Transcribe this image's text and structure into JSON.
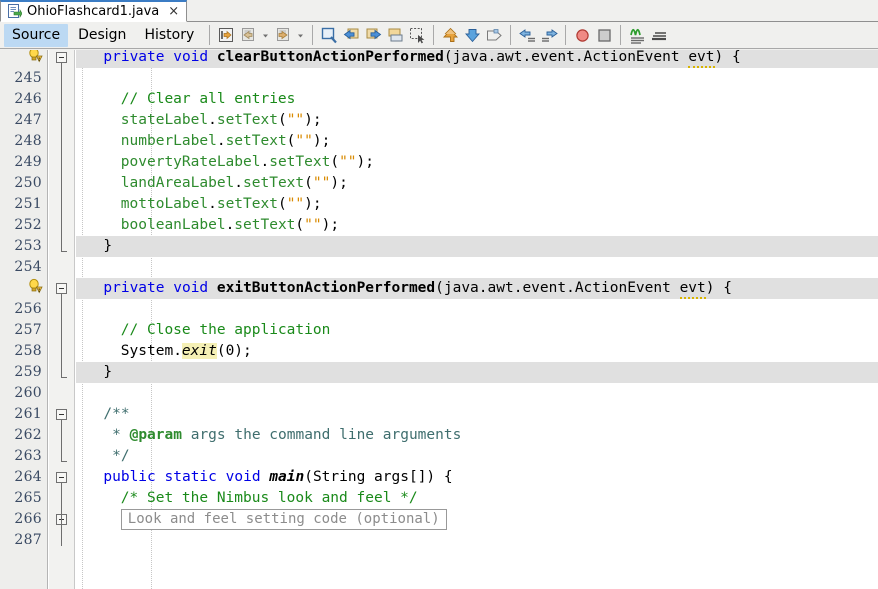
{
  "window": {
    "document_tab": {
      "label": "OhioFlashcard1.java",
      "close_glyph": "×",
      "icon": "java-file-icon"
    },
    "view_tabs": [
      {
        "label": "Source",
        "selected": true
      },
      {
        "label": "Design",
        "selected": false
      },
      {
        "label": "History",
        "selected": false
      }
    ],
    "toolbar": {
      "groups": [
        {
          "items": [
            {
              "name": "last-edit-icon"
            },
            {
              "name": "back-icon"
            },
            {
              "name": "back-dropdown-icon"
            },
            {
              "name": "forward-icon"
            },
            {
              "name": "forward-dropdown-icon"
            }
          ]
        },
        {
          "items": [
            {
              "name": "find-selection-icon"
            },
            {
              "name": "previous-bookmark-icon"
            },
            {
              "name": "next-bookmark-icon"
            },
            {
              "name": "toggle-bookmark-icon"
            },
            {
              "name": "rectangular-selection-icon"
            }
          ]
        },
        {
          "items": [
            {
              "name": "shift-line-up-icon"
            },
            {
              "name": "shift-line-down-icon"
            },
            {
              "name": "comment-icon"
            }
          ]
        },
        {
          "items": [
            {
              "name": "shift-left-icon"
            },
            {
              "name": "shift-right-icon"
            }
          ]
        },
        {
          "items": [
            {
              "name": "toggle-breakpoint-icon"
            },
            {
              "name": "stop-icon"
            }
          ]
        },
        {
          "items": [
            {
              "name": "toggle-highlight-icon"
            },
            {
              "name": "toggle-rectangular-icon"
            }
          ]
        }
      ]
    }
  },
  "editor": {
    "first_visible_line_partial": true,
    "lines": [
      {
        "num": "",
        "indent": 2,
        "highlight": true,
        "fold": "minus",
        "annotation": "warning-bulb-icon",
        "tokens": [
          {
            "t": "private",
            "c": "kw"
          },
          {
            "t": " ",
            "c": ""
          },
          {
            "t": "void",
            "c": "kw"
          },
          {
            "t": " ",
            "c": ""
          },
          {
            "t": "clearButtonActionPerformed",
            "c": "mname"
          },
          {
            "t": "(java.awt.event.ActionEvent ",
            "c": ""
          },
          {
            "t": "evt",
            "c": "warnu"
          },
          {
            "t": ") {",
            "c": ""
          }
        ]
      },
      {
        "num": "245",
        "indent": 0,
        "highlight": false,
        "tokens": []
      },
      {
        "num": "246",
        "indent": 4,
        "highlight": false,
        "tokens": [
          {
            "t": "// Clear all entries",
            "c": "cmt"
          }
        ]
      },
      {
        "num": "247",
        "indent": 4,
        "highlight": false,
        "tokens": [
          {
            "t": "stateLabel",
            "c": "fld"
          },
          {
            "t": ".",
            "c": ""
          },
          {
            "t": "setText",
            "c": "fld"
          },
          {
            "t": "(",
            "c": ""
          },
          {
            "t": "\"\"",
            "c": "str"
          },
          {
            "t": ");",
            "c": ""
          }
        ]
      },
      {
        "num": "248",
        "indent": 4,
        "highlight": false,
        "tokens": [
          {
            "t": "numberLabel",
            "c": "fld"
          },
          {
            "t": ".",
            "c": ""
          },
          {
            "t": "setText",
            "c": "fld"
          },
          {
            "t": "(",
            "c": ""
          },
          {
            "t": "\"\"",
            "c": "str"
          },
          {
            "t": ");",
            "c": ""
          }
        ]
      },
      {
        "num": "249",
        "indent": 4,
        "highlight": false,
        "tokens": [
          {
            "t": "povertyRateLabel",
            "c": "fld"
          },
          {
            "t": ".",
            "c": ""
          },
          {
            "t": "setText",
            "c": "fld"
          },
          {
            "t": "(",
            "c": ""
          },
          {
            "t": "\"\"",
            "c": "str"
          },
          {
            "t": ");",
            "c": ""
          }
        ]
      },
      {
        "num": "250",
        "indent": 4,
        "highlight": false,
        "tokens": [
          {
            "t": "landAreaLabel",
            "c": "fld"
          },
          {
            "t": ".",
            "c": ""
          },
          {
            "t": "setText",
            "c": "fld"
          },
          {
            "t": "(",
            "c": ""
          },
          {
            "t": "\"\"",
            "c": "str"
          },
          {
            "t": ");",
            "c": ""
          }
        ]
      },
      {
        "num": "251",
        "indent": 4,
        "highlight": false,
        "tokens": [
          {
            "t": "mottoLabel",
            "c": "fld"
          },
          {
            "t": ".",
            "c": ""
          },
          {
            "t": "setText",
            "c": "fld"
          },
          {
            "t": "(",
            "c": ""
          },
          {
            "t": "\"\"",
            "c": "str"
          },
          {
            "t": ");",
            "c": ""
          }
        ]
      },
      {
        "num": "252",
        "indent": 4,
        "highlight": false,
        "tokens": [
          {
            "t": "booleanLabel",
            "c": "fld"
          },
          {
            "t": ".",
            "c": ""
          },
          {
            "t": "setText",
            "c": "fld"
          },
          {
            "t": "(",
            "c": ""
          },
          {
            "t": "\"\"",
            "c": "str"
          },
          {
            "t": ");",
            "c": ""
          }
        ]
      },
      {
        "num": "253",
        "indent": 2,
        "highlight": true,
        "fold": "end",
        "tokens": [
          {
            "t": "}",
            "c": ""
          }
        ]
      },
      {
        "num": "254",
        "indent": 0,
        "highlight": false,
        "tokens": []
      },
      {
        "num": "",
        "indent": 2,
        "highlight": true,
        "fold": "minus",
        "annotation": "warning-bulb-icon",
        "tokens": [
          {
            "t": "private",
            "c": "kw"
          },
          {
            "t": " ",
            "c": ""
          },
          {
            "t": "void",
            "c": "kw"
          },
          {
            "t": " ",
            "c": ""
          },
          {
            "t": "exitButtonActionPerformed",
            "c": "mname"
          },
          {
            "t": "(java.awt.event.ActionEvent ",
            "c": ""
          },
          {
            "t": "evt",
            "c": "warnu"
          },
          {
            "t": ") {",
            "c": ""
          }
        ]
      },
      {
        "num": "256",
        "indent": 0,
        "highlight": false,
        "tokens": []
      },
      {
        "num": "257",
        "indent": 4,
        "highlight": false,
        "tokens": [
          {
            "t": "// Close the application",
            "c": "cmt"
          }
        ]
      },
      {
        "num": "258",
        "indent": 4,
        "highlight": false,
        "tokens": [
          {
            "t": "System",
            "c": ""
          },
          {
            "t": ".",
            "c": ""
          },
          {
            "t": "exit",
            "c": "stat"
          },
          {
            "t": "(0);",
            "c": ""
          }
        ]
      },
      {
        "num": "259",
        "indent": 2,
        "highlight": true,
        "fold": "end",
        "tokens": [
          {
            "t": "}",
            "c": ""
          }
        ]
      },
      {
        "num": "260",
        "indent": 0,
        "highlight": false,
        "tokens": []
      },
      {
        "num": "261",
        "indent": 2,
        "highlight": false,
        "fold": "minus",
        "tokens": [
          {
            "t": "/**",
            "c": "jdoc"
          }
        ]
      },
      {
        "num": "262",
        "indent": 2,
        "highlight": false,
        "tokens": [
          {
            "t": " * ",
            "c": "jdoc"
          },
          {
            "t": "@param",
            "c": "jtag"
          },
          {
            "t": " args the command line arguments",
            "c": "jdoc"
          }
        ]
      },
      {
        "num": "263",
        "indent": 2,
        "highlight": false,
        "fold": "end",
        "tokens": [
          {
            "t": " */",
            "c": "jdoc"
          }
        ]
      },
      {
        "num": "264",
        "indent": 2,
        "highlight": false,
        "fold": "minus",
        "tokens": [
          {
            "t": "public",
            "c": "kw"
          },
          {
            "t": " ",
            "c": ""
          },
          {
            "t": "static",
            "c": "kw"
          },
          {
            "t": " ",
            "c": ""
          },
          {
            "t": "void",
            "c": "kw"
          },
          {
            "t": " ",
            "c": ""
          },
          {
            "t": "main",
            "c": "mnameit"
          },
          {
            "t": "(String args[]) {",
            "c": ""
          }
        ]
      },
      {
        "num": "265",
        "indent": 4,
        "highlight": false,
        "tokens": [
          {
            "t": "/* Set the Nimbus look and feel */",
            "c": "cmt"
          }
        ]
      },
      {
        "num": "266",
        "indent": 4,
        "highlight": false,
        "fold": "plus",
        "folded_block": "Look and feel setting code (optional)",
        "tokens": []
      },
      {
        "num": "287",
        "indent": 0,
        "highlight": false,
        "tokens": []
      }
    ]
  },
  "colors": {
    "keyword": "#0000e6",
    "comment": "#1a8a1a",
    "javadoc": "#3f6e6e",
    "field": "#2e8b2e",
    "string": "#d98a00",
    "static_highlight": "#f5f0b5",
    "row_highlight": "#e0e0e0",
    "gutter_bg": "#eeeeec",
    "line_number": "#3a4a63",
    "tab_selected": "#bcd9f3",
    "tab_top_accent": "#3b7cc4"
  }
}
